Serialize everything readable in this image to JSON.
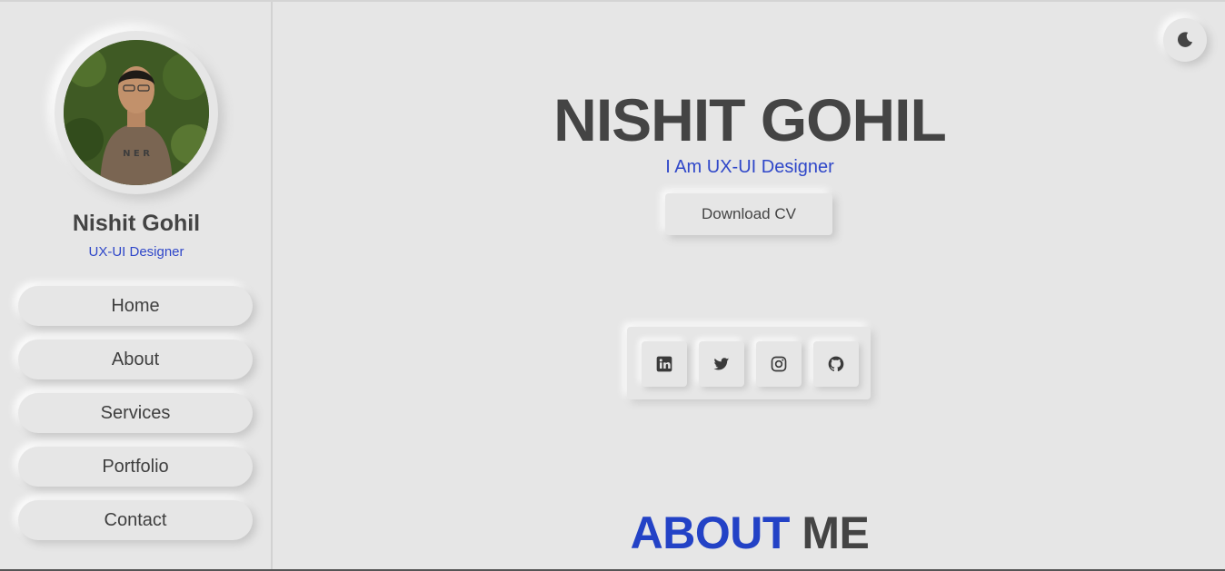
{
  "profile": {
    "name": "Nishit Gohil",
    "role": "UX-UI Designer"
  },
  "nav": {
    "items": [
      {
        "label": "Home"
      },
      {
        "label": "About"
      },
      {
        "label": "Services"
      },
      {
        "label": "Portfolio"
      },
      {
        "label": "Contact"
      }
    ]
  },
  "hero": {
    "name": "NISHIT GOHIL",
    "role": "I Am UX-UI Designer",
    "cv_label": "Download CV"
  },
  "social": {
    "icons": [
      "linkedin-icon",
      "twitter-icon",
      "instagram-icon",
      "github-icon"
    ]
  },
  "about": {
    "accent": "ABOUT",
    "rest": "ME"
  },
  "theme": {
    "icon": "moon-icon",
    "accent_color": "#2f47c9",
    "background": "#e6e6e6",
    "text_color": "#444444"
  }
}
